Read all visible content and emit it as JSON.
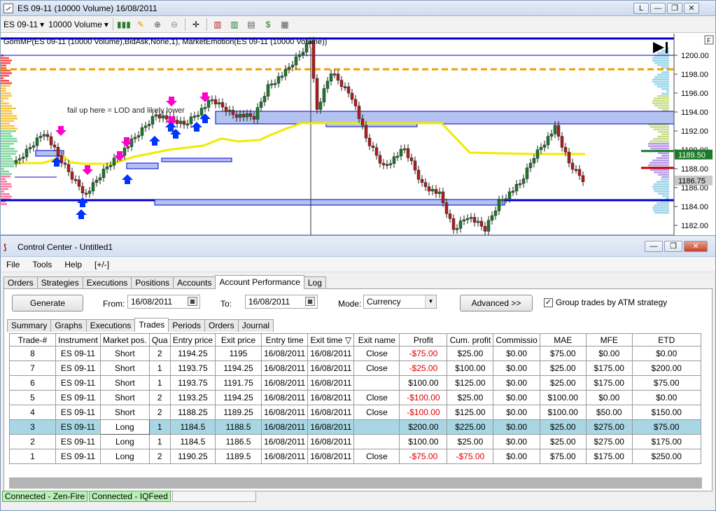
{
  "chart_window": {
    "title": "ES 09-11 (10000 Volume)  16/08/2011",
    "window_buttons": [
      "L",
      "—",
      "❐",
      "✕"
    ],
    "toolbar": {
      "instrument": "ES 09-11",
      "interval": "10000 Volume"
    },
    "indicator_label": "GomMP(ES 09-11 (10000 Volume),BidAsk,None,1), MarketEmotion(ES 09-11 (10000 Volume))",
    "annotation": "fail up here = LOD and likely lower",
    "axis_corner": "F",
    "price_axis": [
      "1200.00",
      "1198.00",
      "1196.00",
      "1194.00",
      "1192.00",
      "1190.00",
      "1188.00",
      "1186.00",
      "1184.00",
      "1182.00"
    ],
    "price_badges": {
      "green": "1189.50",
      "red": "1186.75"
    },
    "colors": {
      "up_candle": "#1b7a2a",
      "down_candle": "#b21c1c",
      "level_line": "#0000cc",
      "dashed_level": "#f0a000",
      "emotion_line": "#f2ea00",
      "zone_fill": "#b3c2f0",
      "arrow_up": "#0033ff",
      "arrow_down": "#ff00cc"
    }
  },
  "control_center": {
    "title": "Control Center - Untitled1",
    "window_buttons": [
      "—",
      "❐",
      "✕"
    ],
    "menu": [
      "File",
      "Tools",
      "Help",
      "[+/-]"
    ],
    "top_tabs": [
      "Orders",
      "Strategies",
      "Executions",
      "Positions",
      "Accounts",
      "Account Performance",
      "Log"
    ],
    "active_top_tab": "Account Performance",
    "generate_label": "Generate",
    "from_label": "From:",
    "from_value": "16/08/2011",
    "to_label": "To:",
    "to_value": "16/08/2011",
    "mode_label": "Mode:",
    "mode_value": "Currency",
    "advanced_label": "Advanced >>",
    "group_label": "Group trades by ATM strategy",
    "group_checked": true,
    "sub_tabs": [
      "Summary",
      "Graphs",
      "Executions",
      "Trades",
      "Periods",
      "Orders",
      "Journal"
    ],
    "active_sub_tab": "Trades",
    "columns": [
      "Trade-#",
      "Instrument",
      "Market pos.",
      "Qua",
      "Entry price",
      "Exit price",
      "Entry time",
      "Exit time ▽",
      "Exit name",
      "Profit",
      "Cum. profit",
      "Commissio",
      "MAE",
      "MFE",
      "ETD"
    ],
    "rows": [
      [
        "8",
        "ES 09-11",
        "Short",
        "2",
        "1194.25",
        "1195",
        "16/08/2011",
        "16/08/2011",
        "Close",
        "-$75.00",
        "$25.00",
        "$0.00",
        "$75.00",
        "$0.00",
        "$0.00"
      ],
      [
        "7",
        "ES 09-11",
        "Short",
        "1",
        "1193.75",
        "1194.25",
        "16/08/2011",
        "16/08/2011",
        "Close",
        "-$25.00",
        "$100.00",
        "$0.00",
        "$25.00",
        "$175.00",
        "$200.00"
      ],
      [
        "6",
        "ES 09-11",
        "Short",
        "1",
        "1193.75",
        "1191.75",
        "16/08/2011",
        "16/08/2011",
        "",
        "$100.00",
        "$125.00",
        "$0.00",
        "$25.00",
        "$175.00",
        "$75.00"
      ],
      [
        "5",
        "ES 09-11",
        "Short",
        "2",
        "1193.25",
        "1194.25",
        "16/08/2011",
        "16/08/2011",
        "Close",
        "-$100.00",
        "$25.00",
        "$0.00",
        "$100.00",
        "$0.00",
        "$0.00"
      ],
      [
        "4",
        "ES 09-11",
        "Short",
        "2",
        "1188.25",
        "1189.25",
        "16/08/2011",
        "16/08/2011",
        "Close",
        "-$100.00",
        "$125.00",
        "$0.00",
        "$100.00",
        "$50.00",
        "$150.00"
      ],
      [
        "3",
        "ES 09-11",
        "Long",
        "1",
        "1184.5",
        "1188.5",
        "16/08/2011",
        "16/08/2011",
        "",
        "$200.00",
        "$225.00",
        "$0.00",
        "$25.00",
        "$275.00",
        "$75.00"
      ],
      [
        "2",
        "ES 09-11",
        "Long",
        "1",
        "1184.5",
        "1186.5",
        "16/08/2011",
        "16/08/2011",
        "",
        "$100.00",
        "$25.00",
        "$0.00",
        "$25.00",
        "$275.00",
        "$175.00"
      ],
      [
        "1",
        "ES 09-11",
        "Long",
        "2",
        "1190.25",
        "1189.5",
        "16/08/2011",
        "16/08/2011",
        "Close",
        "-$75.00",
        "-$75.00",
        "$0.00",
        "$75.00",
        "$175.00",
        "$250.00"
      ]
    ],
    "selected_row": 5,
    "status": [
      "Connected - Zen-Fire",
      "Connected - IQFeed"
    ]
  }
}
